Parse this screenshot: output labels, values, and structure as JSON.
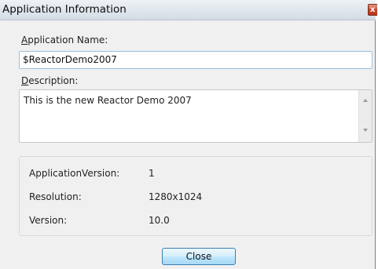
{
  "window": {
    "title": "Application Information",
    "close_glyph": "x"
  },
  "app_name": {
    "label_access_key": "A",
    "label_rest": "pplication Name:",
    "value": "$ReactorDemo2007"
  },
  "description": {
    "label_access_key": "D",
    "label_rest": "escription:",
    "value": "This is the new Reactor Demo 2007"
  },
  "info": [
    {
      "key": "ApplicationVersion:",
      "value": "1"
    },
    {
      "key": "Resolution:",
      "value": "1280x1024"
    },
    {
      "key": "Version:",
      "value": "10.0"
    }
  ],
  "buttons": {
    "close_label": "Close"
  },
  "icons": {
    "title_close": "close-icon",
    "scroll_up": "scroll-up-arrow-icon",
    "scroll_down": "scroll-down-arrow-icon"
  }
}
